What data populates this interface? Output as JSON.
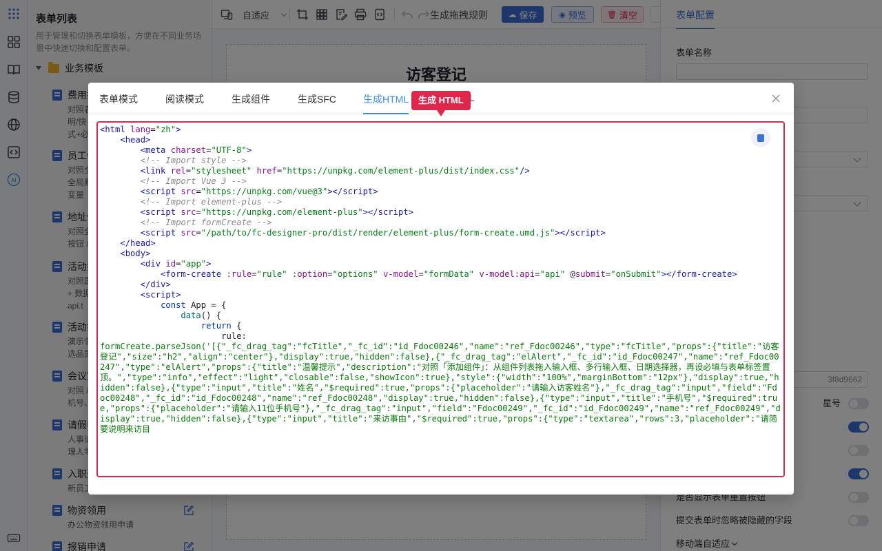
{
  "sidebar_rail": {
    "icons": [
      "apps-grid-icon",
      "components-icon",
      "book-icon",
      "database-icon",
      "globe-icon",
      "code-icon",
      "ai-icon",
      "keyboard-icon"
    ]
  },
  "list_panel": {
    "title": "表单列表",
    "description": "用于管理和切换表单模板，方便在不同业务场景中快速切换和配置表单。",
    "folder": "业务模板",
    "items": [
      {
        "title": "费用报",
        "desc": "对照表\n明/快\n式+必"
      },
      {
        "title": "员工信",
        "desc": "对照全\n全局默\n变量"
      },
      {
        "title": "地址信",
        "desc": "对照全\n按钮 /"
      },
      {
        "title": "活动报",
        "desc": "对照国\n+ 数据\napi.t"
      },
      {
        "title": "活动报",
        "desc": "演示邻\n选品国"
      },
      {
        "title": "会议室",
        "desc": "对照 /\n机号、"
      },
      {
        "title": "请假申",
        "desc": "人事请\n理人零"
      },
      {
        "title": "入职登",
        "desc": "新员工"
      },
      {
        "title": "物资领用",
        "desc": "办公物资领用申请"
      },
      {
        "title": "报销申请",
        "desc": ""
      }
    ]
  },
  "toolbar": {
    "adaptive": "自适应",
    "gen_rule": "生成拖拽规则",
    "save": "保存",
    "preview": "预览",
    "clear": "清空"
  },
  "canvas": {
    "form_title": "访客登记"
  },
  "config_panel": {
    "tab": "表单配置",
    "form_name_label": "表单名称",
    "id_fragment": "3f8d9662",
    "star_label": "星号",
    "label_show_reset": "是否显示表单重置按钮",
    "label_ignore_hidden": "提交表单时忽略被隐藏的字段",
    "label_mobile": "移动端自适应"
  },
  "modal": {
    "tabs": [
      "表单模式",
      "阅读模式",
      "生成组件",
      "生成SFC",
      "生成HTML",
      "L"
    ],
    "active_tab": "生成HTML",
    "tooltip": "生成 HTML",
    "json_line1": "formCreate.parseJson('[{\"_fc_drag_tag\":\"fcTitle\",\"_fc_id\":\"id_Fdoc00246\",\"name\":\"ref_Fdoc00246\",\"type\":\"fcTitle\",\"props\":{\"title\":\"访客登记\",\"size\":\"h2\",\"align\":\"center\"},\"display\":true,\"hidden\":false},{\"_fc_drag_tag\":\"elAlert\",\"_fc_id\":\"id_Fdoc00247\",\"name\":\"ref_Fdoc00247\",\"type\":\"elAlert\",\"props\":{\"title\":\"温馨提示\",\"description\":\"对照「添加组件」：从组件列表拖入输入框、多行输入框、日期选择器，再设必填与表单标签置顶。\",\"type\":\"info\",\"effect\":\"light\",\"closable\":false,\"showIcon\":true},\"style\":{\"width\":\"100%\",\"marginBottom\":\"12px\"},\"display\":true,\"hidden\":false},{\"type\":\"input\",\"title\":\"姓名\",\"$required\":true,\"props\":{\"placeholder\":\"请输入访客姓名\"},\"_fc_drag_tag\":\"input\",\"field\":\"Fdoc00248\",\"_fc_id\":\"id_Fdoc00248\",\"name\":\"ref_Fdoc00248\",\"display\":true,\"hidden\":false},{\"type\":\"input\",\"title\":\"手机号\",\"$required\":true,\"props\":{\"placeholder\":\"请输入11位手机号\"},\"_fc_drag_tag\":\"input\",\"field\":\"Fdoc00249\",\"_fc_id\":\"id_Fdoc00249\",\"name\":\"ref_Fdoc00249\",\"display\":true,\"hidden\":false},{\"type\":\"input\",\"title\":\"来访事由\",\"$required\":true,\"props\":{\"type\":\"textarea\",\"rows\":3,\"placeholder\":\"请简要说明来访目"
  }
}
